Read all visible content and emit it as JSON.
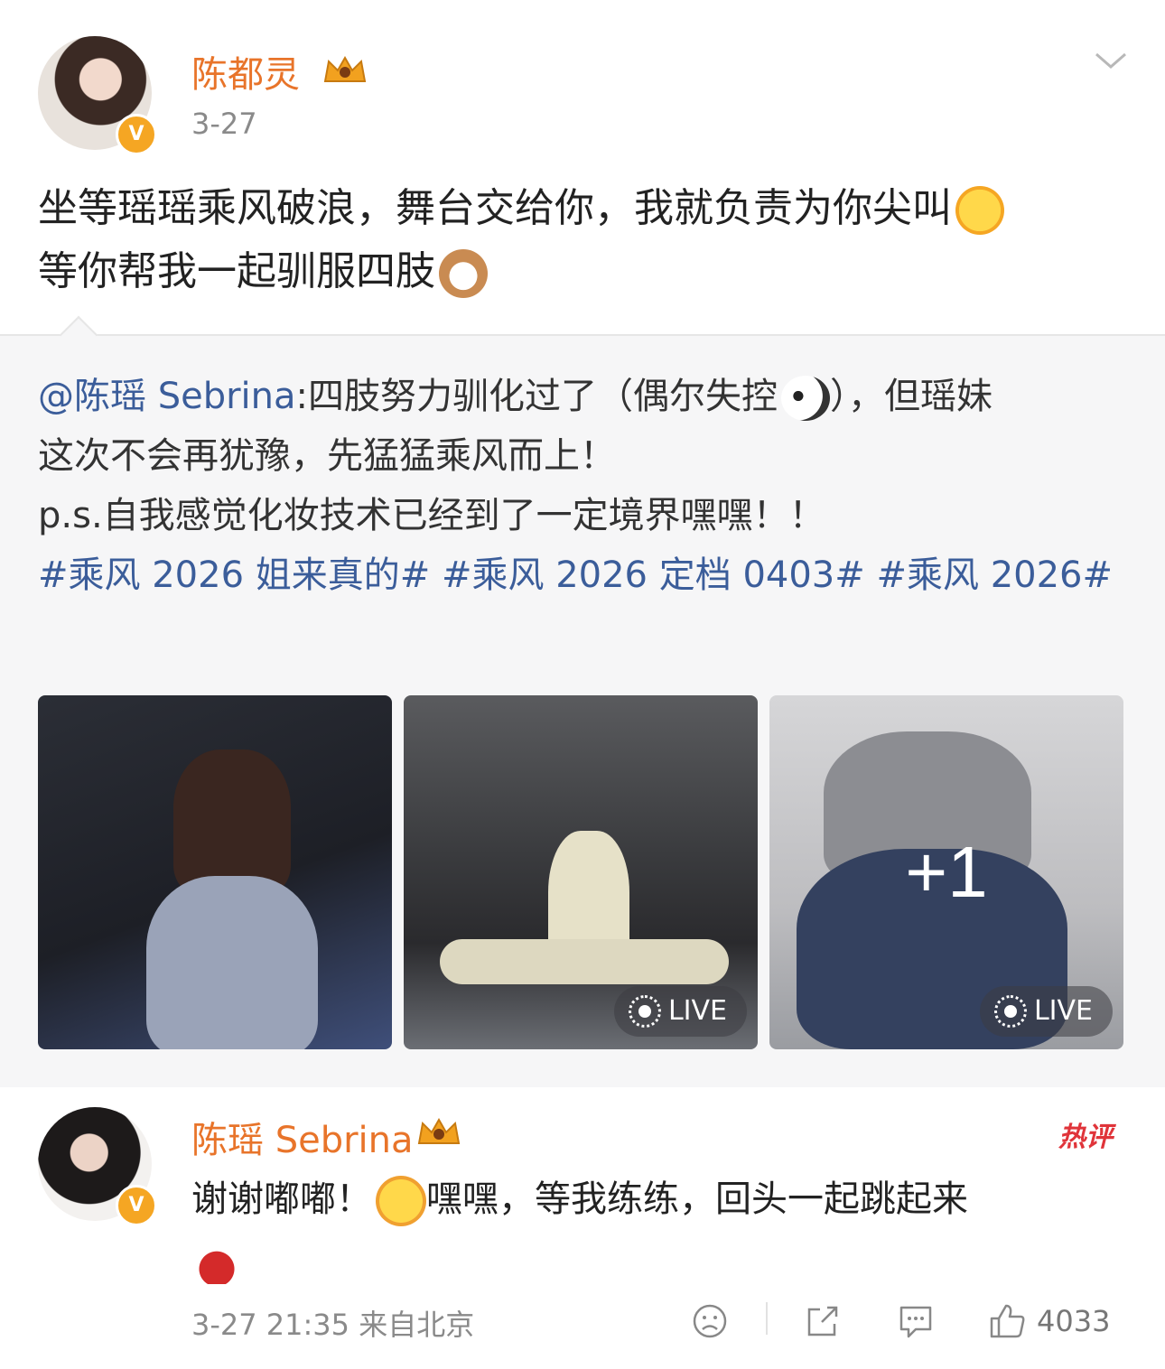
{
  "post": {
    "author": "陈都灵",
    "time": "3-27",
    "text_line1": "坐等瑶瑶乘风破浪，舞台交给你，我就负责为你尖叫",
    "text_line2": "等你帮我一起驯服四肢",
    "emoji1": "flower-smile-emoji",
    "emoji2": "cat-face-emoji"
  },
  "repost": {
    "mention": "@陈瑶 Sebrina",
    "text_part1": ":四肢努力驯化过了（偶尔失控",
    "text_part2": "），但瑶妹",
    "line2": "这次不会再犹豫，先猛猛乘风而上！",
    "line3": "p.s.自我感觉化妆技术已经到了一定境界嘿嘿！！",
    "hashtags": [
      "#乘风 2026 姐来真的#",
      "#乘风 2026 定档 0403#",
      "#乘风 2026#"
    ],
    "images": [
      {
        "live": false,
        "more": ""
      },
      {
        "live": true,
        "more": ""
      },
      {
        "live": true,
        "more": "+1"
      }
    ],
    "live_label": "LIVE"
  },
  "reply": {
    "author": "陈瑶 Sebrina",
    "hot_label": "热评",
    "text_part1": "谢谢嘟嘟！",
    "text_part2": "嘿嘿，等我练练，回头一起跳起来",
    "meta": "3-27 21:35  来自北京",
    "likes": "4033"
  },
  "colors": {
    "username": "#e8742a",
    "link": "#3b5d9a",
    "hot": "#e0343a"
  }
}
